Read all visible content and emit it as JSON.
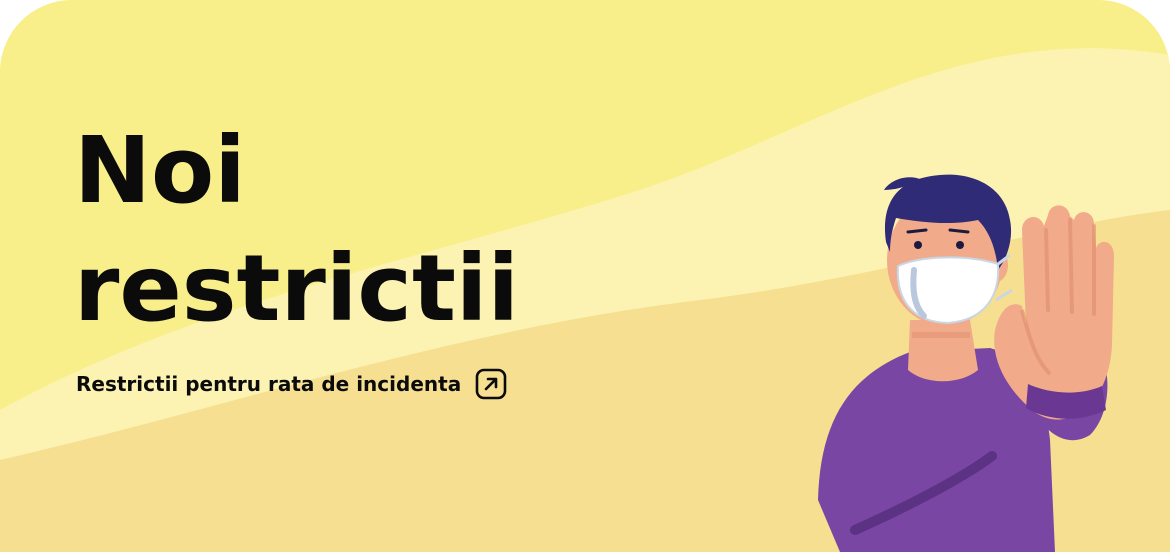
{
  "banner": {
    "title_line1": "Noi",
    "title_line2": "restrictii",
    "link_label": "Restrictii pentru rata de incidenta",
    "link_icon": "external-link-arrow-icon"
  },
  "colors": {
    "bg_yellow": "#f9ef8a",
    "bg_light_wave": "#fcf3b3",
    "bg_sand": "#f6df90",
    "text": "#0b0b0b",
    "shirt": "#7a46a3",
    "hair": "#2f2b77",
    "skin": "#f1ab8a"
  }
}
